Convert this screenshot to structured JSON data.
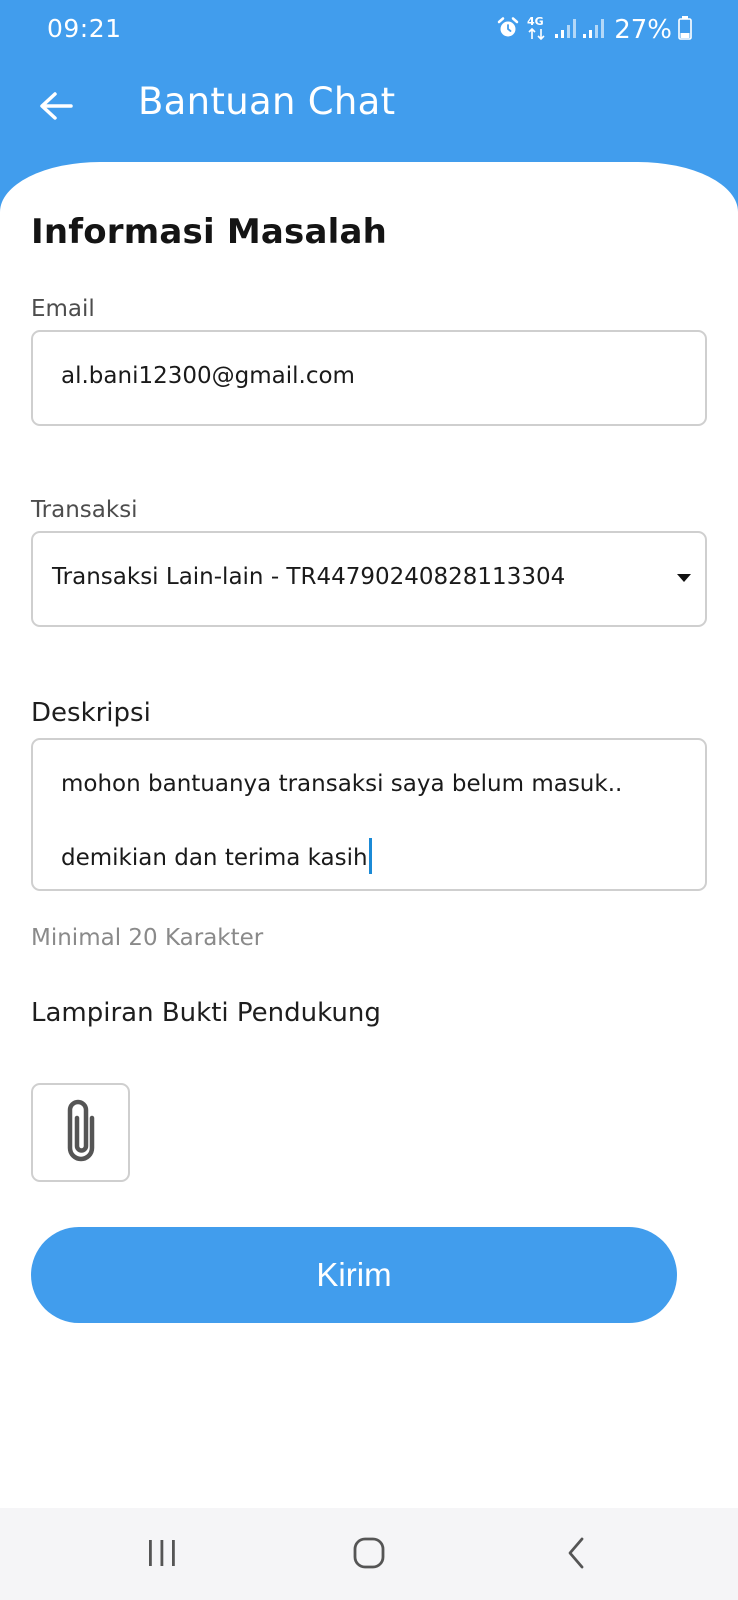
{
  "status_bar": {
    "time": "09:21",
    "network": "4G",
    "battery": "27%",
    "icons": [
      "alarm-icon",
      "network-4g-icon",
      "signal-icon",
      "signal-icon",
      "battery-icon"
    ]
  },
  "app_bar": {
    "back_icon": "arrow-left-icon",
    "title": "Bantuan Chat"
  },
  "form": {
    "section_title": "Informasi Masalah",
    "email": {
      "label": "Email",
      "value": "al.bani12300@gmail.com"
    },
    "transaction": {
      "label": "Transaksi",
      "selected": "Transaksi Lain-lain - TR44790240828113304",
      "icon": "dropdown-caret-icon"
    },
    "description": {
      "label": "Deskripsi",
      "lines": [
        "mohon bantuanya transaksi saya belum masuk..",
        "demikian dan terima kasih"
      ],
      "helper": "Minimal 20 Karakter"
    },
    "attachment": {
      "label": "Lampiran Bukti Pendukung",
      "icon": "paperclip-icon"
    },
    "submit_label": "Kirim"
  },
  "nav_bar": {
    "icons": [
      "recent-apps-icon",
      "home-icon",
      "back-icon"
    ]
  },
  "colors": {
    "primary": "#419ded",
    "border": "#cfcfcf",
    "helper_text": "#8a8a8a",
    "cursor": "#1b8ad6"
  }
}
